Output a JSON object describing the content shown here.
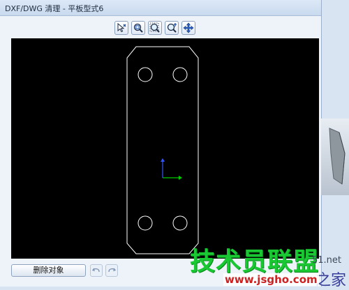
{
  "window": {
    "title": "DXF/DWG 清理 - 平板型式6"
  },
  "toolbar": {
    "buttons": [
      {
        "icon": "select-cursor-icon"
      },
      {
        "icon": "zoom-fit-icon"
      },
      {
        "icon": "zoom-area-icon"
      },
      {
        "icon": "zoom-in-out-icon"
      },
      {
        "icon": "pan-icon"
      }
    ]
  },
  "viewport": {
    "background": "#000000",
    "line_color": "#ffffff",
    "axis_colors": {
      "x": "#00cc00",
      "y": "#3355ff"
    }
  },
  "bottom": {
    "delete_label": "删除对象",
    "undo_icon": "undo-icon",
    "redo_icon": "redo-icon"
  },
  "watermark": {
    "main": "技术员联盟",
    "tail": "51.net",
    "url": "www.jsgho.com",
    "suffix": "之家"
  }
}
